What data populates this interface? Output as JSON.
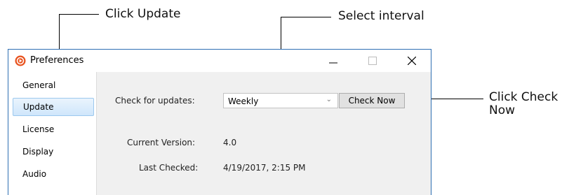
{
  "callouts": {
    "click_update": "Click Update",
    "select_interval": "Select interval",
    "click_check_now_line1": "Click Check",
    "click_check_now_line2": "Now"
  },
  "window": {
    "title": "Preferences",
    "app_icon": "record-icon",
    "controls": [
      "minimize-icon",
      "maximize-icon",
      "close-icon"
    ]
  },
  "sidebar": {
    "items": [
      {
        "label": "General",
        "selected": false
      },
      {
        "label": "Update",
        "selected": true
      },
      {
        "label": "License",
        "selected": false
      },
      {
        "label": "Display",
        "selected": false
      },
      {
        "label": "Audio",
        "selected": false
      }
    ]
  },
  "update_panel": {
    "check_label": "Check for updates:",
    "interval_value": "Weekly",
    "check_now_label": "Check Now",
    "current_version_label": "Current Version:",
    "current_version_value": "4.0",
    "last_checked_label": "Last Checked:",
    "last_checked_value": "4/19/2017, 2:15 PM"
  },
  "colors": {
    "window_border": "#2f6fb3",
    "selection": "#cfe6fb",
    "app_icon": "#e8531f"
  }
}
